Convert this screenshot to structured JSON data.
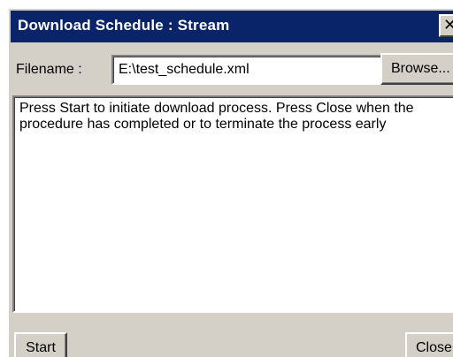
{
  "window": {
    "title": "Download Schedule : Stream",
    "close_glyph": "✕"
  },
  "file": {
    "label": "Filename :",
    "value": "E:\\test_schedule.xml",
    "browse_label": "Browse..."
  },
  "log": {
    "text": "Press Start to initiate download process. Press Close when the procedure has completed or to terminate the process early"
  },
  "actions": {
    "start_label": "Start",
    "close_label": "Close"
  },
  "colors": {
    "titlebar": "#0a246a",
    "face": "#d4d0c8"
  },
  "icons": {
    "close": "close-icon"
  }
}
